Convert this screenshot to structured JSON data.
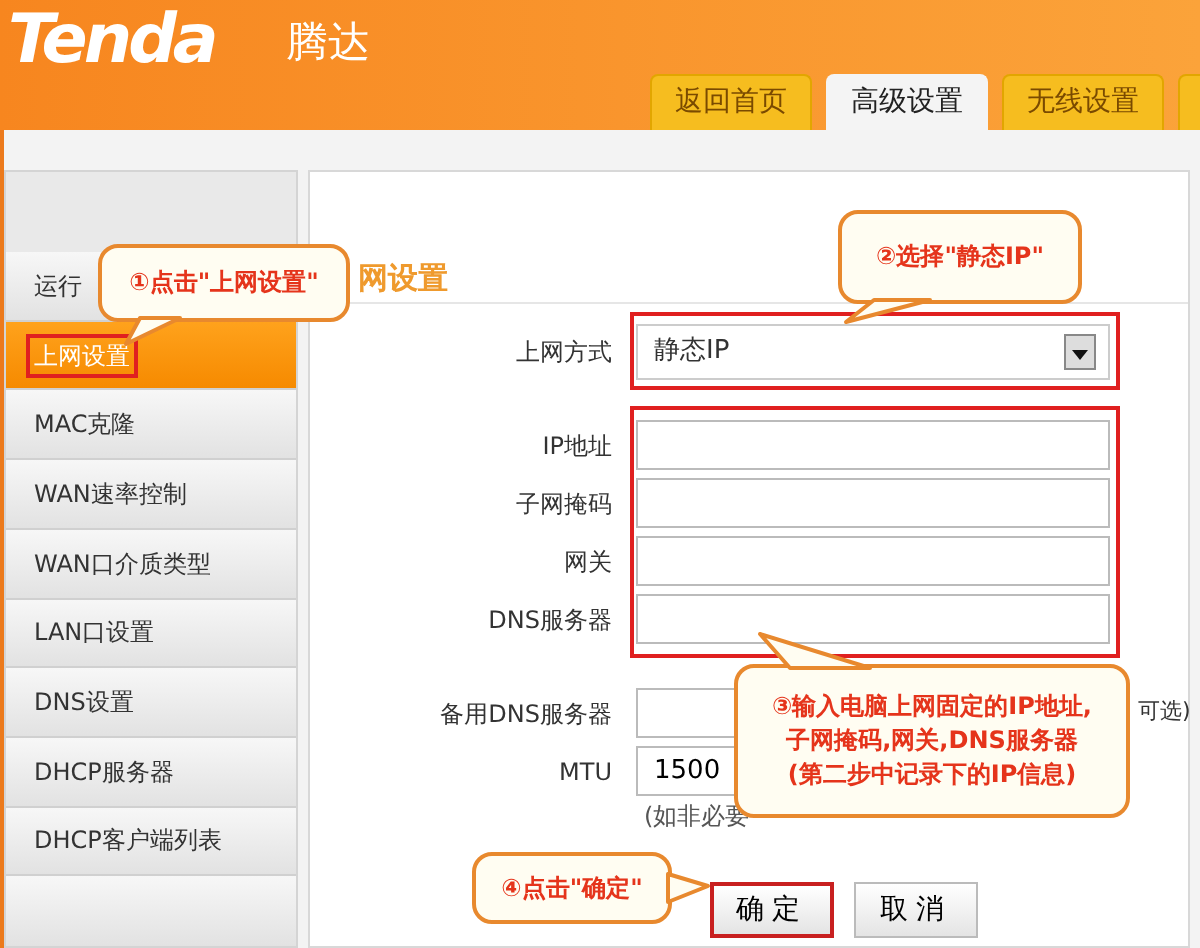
{
  "header": {
    "logo": "Tenda",
    "brand": "腾达"
  },
  "tabs": [
    {
      "kind": "tab",
      "label": "返回首页",
      "selected": false
    },
    {
      "kind": "tab",
      "label": "高级设置",
      "selected": true
    },
    {
      "kind": "tab",
      "label": "无线设置",
      "selected": false
    },
    {
      "kind": "partial",
      "selected": false
    }
  ],
  "sidebar": {
    "items": [
      {
        "label": "运行",
        "selected": false,
        "highlighted": false
      },
      {
        "label": "上网设置",
        "selected": true,
        "highlighted": true
      },
      {
        "label": "MAC克隆",
        "selected": false,
        "highlighted": false
      },
      {
        "label": "WAN速率控制",
        "selected": false,
        "highlighted": false
      },
      {
        "label": "WAN口介质类型",
        "selected": false,
        "highlighted": false
      },
      {
        "label": "LAN口设置",
        "selected": false,
        "highlighted": false
      },
      {
        "label": "DNS设置",
        "selected": false,
        "highlighted": false
      },
      {
        "label": "DHCP服务器",
        "selected": false,
        "highlighted": false
      },
      {
        "label": "DHCP客户端列表",
        "selected": false,
        "highlighted": false
      }
    ]
  },
  "panel": {
    "title": "网设置",
    "field_groups": [
      {
        "highlighted": true,
        "fields": [
          {
            "label": "上网方式",
            "kind": "select",
            "value": "静态IP"
          }
        ]
      },
      {
        "highlighted": true,
        "fields": [
          {
            "label": "IP地址",
            "kind": "text"
          },
          {
            "label": "子网掩码",
            "kind": "text"
          },
          {
            "label": "网关",
            "kind": "text"
          },
          {
            "label": "DNS服务器",
            "kind": "text"
          }
        ]
      },
      {
        "highlighted": false,
        "fields": [
          {
            "label": "备用DNS服务器",
            "kind": "text",
            "suffix": "可选)"
          },
          {
            "label": "MTU",
            "kind": "text",
            "value": "1500"
          }
        ]
      }
    ],
    "note": "(如非必要",
    "buttons": [
      {
        "label": "确定",
        "highlighted": true
      },
      {
        "label": "取消",
        "highlighted": false
      }
    ]
  },
  "callouts": [
    {
      "lines": [
        "①点击\"上网设置\""
      ]
    },
    {
      "lines": [
        "②选择\"静态IP\""
      ]
    },
    {
      "lines": [
        "③输入电脑上网固定的IP地址,",
        "子网掩码,网关,DNS服务器",
        "(第二步中记录下的IP信息)"
      ]
    },
    {
      "lines": [
        "④点击\"确定\""
      ]
    }
  ]
}
